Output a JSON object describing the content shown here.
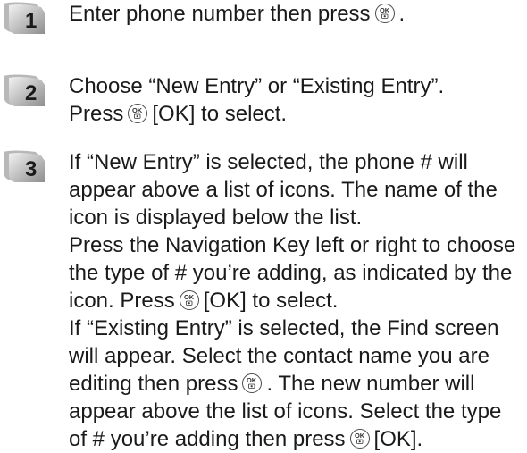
{
  "steps": [
    {
      "number": "1",
      "lines": [
        [
          "Enter phone number then press",
          "ok",
          "."
        ]
      ]
    },
    {
      "number": "2",
      "lines": [
        [
          "Choose “New Entry” or “Existing Entry”."
        ],
        [
          "Press",
          "ok",
          "[OK] to select."
        ]
      ]
    },
    {
      "number": "3",
      "lines": [
        [
          "If “New Entry” is selected, the phone # will"
        ],
        [
          "appear above a list of icons. The name of the"
        ],
        [
          "icon is displayed below the list."
        ],
        [
          "Press the Navigation Key left or right to choose"
        ],
        [
          "the type of # you’re adding, as indicated by the"
        ],
        [
          "icon. Press",
          "ok",
          "[OK] to select."
        ],
        [
          "If “Existing Entry” is selected, the Find screen"
        ],
        [
          "will appear. Select the contact name you are"
        ],
        [
          "editing then press",
          "ok",
          ". The new number will"
        ],
        [
          "appear above the list of icons. Select the type"
        ],
        [
          "of # you’re adding then press",
          "ok",
          "[OK]."
        ]
      ]
    }
  ],
  "ok_key": {
    "label": "OK",
    "icon": "camera-icon"
  }
}
